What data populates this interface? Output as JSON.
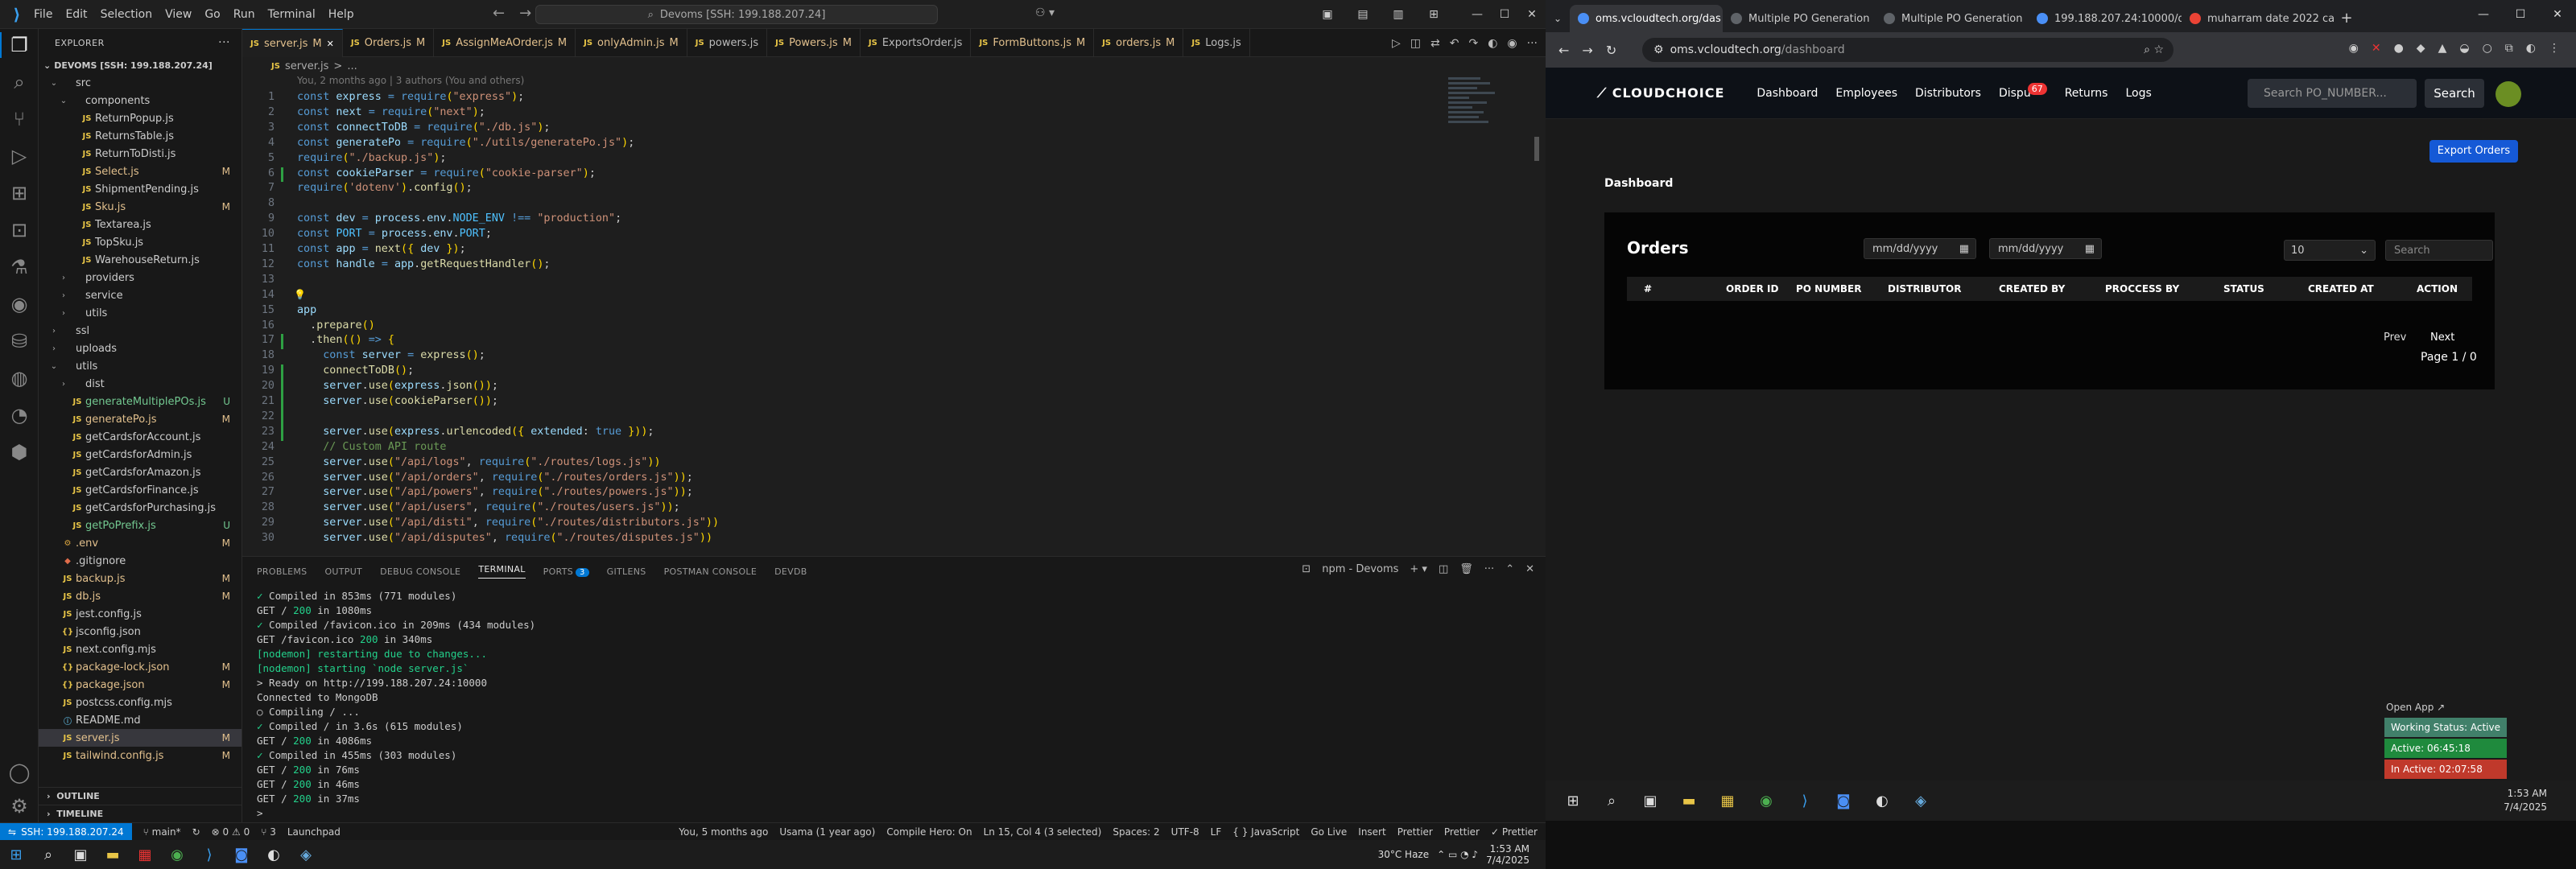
{
  "vscode": {
    "menu": [
      "File",
      "Edit",
      "Selection",
      "View",
      "Go",
      "Run",
      "Terminal",
      "Help"
    ],
    "command_center": "Devoms [SSH: 199.188.207.24]",
    "explorer_title": "EXPLORER",
    "project": "DEVOMS [SSH: 199.188.207.24]",
    "tree": [
      {
        "label": "src",
        "indent": 1,
        "type": "folder",
        "open": true
      },
      {
        "label": "components",
        "indent": 2,
        "type": "folder",
        "open": true
      },
      {
        "label": "ReturnPopup.js",
        "indent": 3,
        "type": "js"
      },
      {
        "label": "ReturnsTable.js",
        "indent": 3,
        "type": "js"
      },
      {
        "label": "ReturnToDisti.js",
        "indent": 3,
        "type": "js"
      },
      {
        "label": "Select.js",
        "indent": 3,
        "type": "js",
        "status": "M"
      },
      {
        "label": "ShipmentPending.js",
        "indent": 3,
        "type": "js"
      },
      {
        "label": "Sku.js",
        "indent": 3,
        "type": "js",
        "status": "M"
      },
      {
        "label": "Textarea.js",
        "indent": 3,
        "type": "js"
      },
      {
        "label": "TopSku.js",
        "indent": 3,
        "type": "js"
      },
      {
        "label": "WarehouseReturn.js",
        "indent": 3,
        "type": "js"
      },
      {
        "label": "providers",
        "indent": 2,
        "type": "folder",
        "open": false
      },
      {
        "label": "service",
        "indent": 2,
        "type": "folder",
        "open": false
      },
      {
        "label": "utils",
        "indent": 2,
        "type": "folder",
        "open": false
      },
      {
        "label": "ssl",
        "indent": 1,
        "type": "folder",
        "open": false
      },
      {
        "label": "uploads",
        "indent": 1,
        "type": "folder",
        "open": false
      },
      {
        "label": "utils",
        "indent": 1,
        "type": "folder",
        "open": true
      },
      {
        "label": "dist",
        "indent": 2,
        "type": "folder",
        "open": false
      },
      {
        "label": "generateMultiplePOs.js",
        "indent": 2,
        "type": "js",
        "status": "U"
      },
      {
        "label": "generatePo.js",
        "indent": 2,
        "type": "js",
        "status": "M"
      },
      {
        "label": "getCardsforAccount.js",
        "indent": 2,
        "type": "js"
      },
      {
        "label": "getCardsforAdmin.js",
        "indent": 2,
        "type": "js"
      },
      {
        "label": "getCardsforAmazon.js",
        "indent": 2,
        "type": "js"
      },
      {
        "label": "getCardsforFinance.js",
        "indent": 2,
        "type": "js"
      },
      {
        "label": "getCardsforPurchasing.js",
        "indent": 2,
        "type": "js"
      },
      {
        "label": "getPoPrefix.js",
        "indent": 2,
        "type": "js",
        "status": "U"
      },
      {
        "label": ".env",
        "indent": 1,
        "type": "env",
        "status": "M"
      },
      {
        "label": ".gitignore",
        "indent": 1,
        "type": "git"
      },
      {
        "label": "backup.js",
        "indent": 1,
        "type": "js",
        "status": "M"
      },
      {
        "label": "db.js",
        "indent": 1,
        "type": "js",
        "status": "M"
      },
      {
        "label": "jest.config.js",
        "indent": 1,
        "type": "js"
      },
      {
        "label": "jsconfig.json",
        "indent": 1,
        "type": "json"
      },
      {
        "label": "next.config.mjs",
        "indent": 1,
        "type": "js"
      },
      {
        "label": "package-lock.json",
        "indent": 1,
        "type": "json",
        "status": "M"
      },
      {
        "label": "package.json",
        "indent": 1,
        "type": "json",
        "status": "M"
      },
      {
        "label": "postcss.config.mjs",
        "indent": 1,
        "type": "js"
      },
      {
        "label": "README.md",
        "indent": 1,
        "type": "md"
      },
      {
        "label": "server.js",
        "indent": 1,
        "type": "js",
        "status": "M",
        "selected": true
      },
      {
        "label": "tailwind.config.js",
        "indent": 1,
        "type": "js",
        "status": "M"
      }
    ],
    "outline": "OUTLINE",
    "timeline": "TIMELINE",
    "tabs": [
      {
        "label": "server.js",
        "mod": "M",
        "active": true
      },
      {
        "label": "Orders.js",
        "mod": "M"
      },
      {
        "label": "AssignMeAOrder.js",
        "mod": "M"
      },
      {
        "label": "onlyAdmin.js",
        "mod": "M"
      },
      {
        "label": "powers.js",
        "mod": ""
      },
      {
        "label": "Powers.js",
        "mod": "M"
      },
      {
        "label": "ExportsOrder.js",
        "mod": ""
      },
      {
        "label": "FormButtons.js",
        "mod": "M"
      },
      {
        "label": "orders.js",
        "mod": "M"
      },
      {
        "label": "Logs.js",
        "mod": ""
      }
    ],
    "breadcrumb": [
      "server.js",
      ">",
      "..."
    ],
    "blame": "You, 2 months ago | 3 authors (You and others)",
    "panel_tabs": [
      "PROBLEMS",
      "OUTPUT",
      "DEBUG CONSOLE",
      "TERMINAL",
      "PORTS",
      "GITLENS",
      "POSTMAN CONSOLE",
      "DEVDB"
    ],
    "ports_count": "3",
    "terminal_title": "npm - Devoms",
    "status": {
      "remote": "SSH: 199.188.207.24",
      "branch": "main*",
      "sync": "↻",
      "errors": "⊗ 0 ⚠ 0",
      "ports": "⑂ 3",
      "launch": "Launchpad",
      "blame": "You, 5 months ago",
      "author": "Usama (1 year ago)",
      "compile": "Compile Hero: On",
      "position": "Ln 15, Col 4 (3 selected)",
      "spaces": "Spaces: 2",
      "encoding": "UTF-8",
      "eol": "LF",
      "lang": "{ } JavaScript",
      "golive": "Go Live",
      "insert": "Insert",
      "prettier1": "Prettier",
      "prettier2": "Prettier",
      "prettier3": "✓ Prettier"
    },
    "weather": "30°C  Haze",
    "clock_time": "1:53 AM",
    "clock_date": "7/4/2025"
  },
  "code_lines": [
    "const express = require(\"express\");",
    "const next = require(\"next\");",
    "const connectToDB = require(\"./db.js\");",
    "const generatePo = require(\"./utils/generatePo.js\");",
    "require(\"./backup.js\");",
    "const cookieParser = require(\"cookie-parser\");",
    "require('dotenv').config();",
    "",
    "const dev = process.env.NODE_ENV !== \"production\";",
    "const PORT = process.env.PORT;",
    "const app = next({ dev });",
    "const handle = app.getRequestHandler();",
    "",
    "",
    "app",
    "  .prepare()",
    "  .then(() => {",
    "    const server = express();",
    "    connectToDB();",
    "    server.use(express.json());",
    "    server.use(cookieParser());",
    "",
    "    server.use(express.urlencoded({ extended: true }));",
    "    // Custom API route",
    "    server.use(\"/api/logs\", require(\"./routes/logs.js\"))",
    "    server.use(\"/api/orders\", require(\"./routes/orders.js\"));",
    "    server.use(\"/api/powers\", require(\"./routes/powers.js\"));",
    "    server.use(\"/api/users\", require(\"./routes/users.js\"));",
    "    server.use(\"/api/disti\", require(\"./routes/distributors.js\"))",
    "    server.use(\"/api/disputes\", require(\"./routes/disputes.js\"))"
  ],
  "terminal_lines": [
    "✓ Compiled in 853ms (771 modules)",
    "GET / 200 in 1080ms",
    "✓ Compiled /favicon.ico in 209ms (434 modules)",
    "GET /favicon.ico 200 in 340ms",
    "[nodemon] restarting due to changes...",
    "[nodemon] starting `node server.js`",
    "> Ready on http://199.188.207.24:10000",
    "Connected to MongoDB",
    "○ Compiling / ...",
    "✓ Compiled / in 3.6s (615 modules)",
    "GET / 200 in 4086ms",
    "✓ Compiled in 455ms (303 modules)",
    "GET / 200 in 76ms",
    "GET / 200 in 46ms",
    "GET / 200 in 37ms",
    ">"
  ],
  "browser": {
    "tabs": [
      {
        "label": "oms.vcloudtech.org/das",
        "active": true
      },
      {
        "label": "Multiple PO Generation"
      },
      {
        "label": "Multiple PO Generation"
      },
      {
        "label": "199.188.207.24:10000/d"
      },
      {
        "label": "muharram date 2022 ca"
      }
    ],
    "url_host": "oms.vcloudtech.org",
    "url_path": "/dashboard",
    "site": {
      "logo": "CLOUDCHOICE",
      "nav": [
        "Dashboard",
        "Employees",
        "Distributors",
        "Dispu",
        "Returns",
        "Logs"
      ],
      "disputes_badge": "67",
      "search_placeholder": "Search PO_NUMBER...",
      "search_button": "Search",
      "export_button": "Export Orders",
      "page_title": "Dashboard",
      "card_title": "Orders",
      "date_placeholder": "mm/dd/yyyy",
      "page_size": "10",
      "search_box": "Search",
      "columns": [
        "#",
        "ORDER ID",
        "PO NUMBER",
        "DISTRIBUTOR",
        "CREATED BY",
        "PROCCESS BY",
        "STATUS",
        "CREATED AT",
        "ACTION"
      ],
      "prev": "Prev",
      "next": "Next",
      "page_info": "Page 1 / 0"
    },
    "open_app": "Open App ↗",
    "working_status": "Working Status: Active",
    "active_time": "Active: 06:45:18",
    "inactive_time": "In Active: 02:07:58",
    "clock_time": "1:53 AM",
    "clock_date": "7/4/2025"
  }
}
